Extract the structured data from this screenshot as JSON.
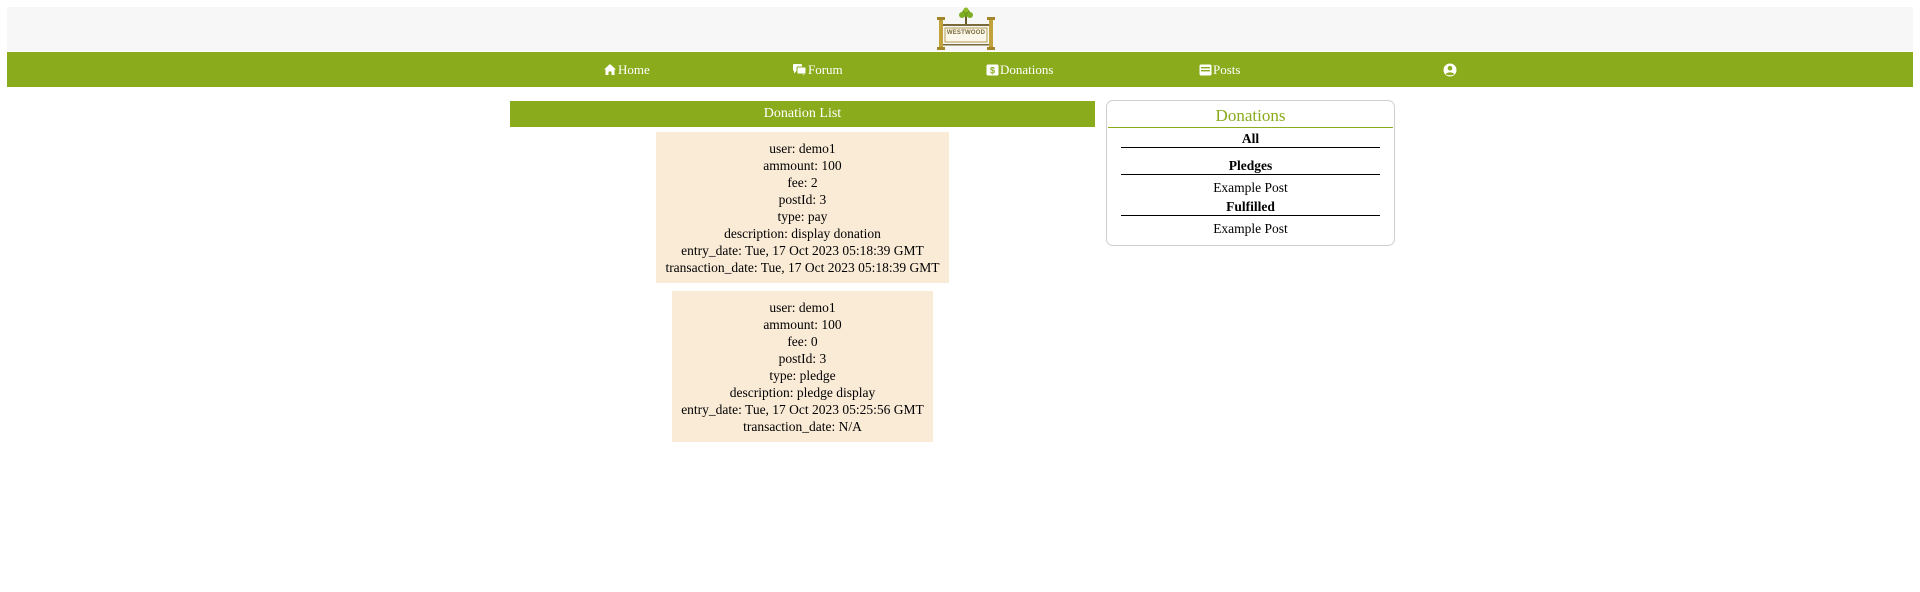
{
  "header": {
    "logo_text": "WESTWOOD"
  },
  "nav": {
    "items": [
      {
        "label": "Home",
        "icon": "home-icon"
      },
      {
        "label": "Forum",
        "icon": "chat-icon"
      },
      {
        "label": "Donations",
        "icon": "dollar-icon"
      },
      {
        "label": "Posts",
        "icon": "inbox-icon"
      },
      {
        "label": "",
        "icon": "user-circle-icon"
      }
    ]
  },
  "main": {
    "title": "Donation List",
    "donations": [
      {
        "user": "user: demo1",
        "ammount": "ammount: 100",
        "fee": "fee: 2",
        "postId": "postId: 3",
        "type": "type: pay",
        "description": "description: display donation",
        "entry_date": "entry_date: Tue, 17 Oct 2023 05:18:39 GMT",
        "transaction_date": "transaction_date: Tue, 17 Oct 2023 05:18:39 GMT"
      },
      {
        "user": "user: demo1",
        "ammount": "ammount: 100",
        "fee": "fee: 0",
        "postId": "postId: 3",
        "type": "type: pledge",
        "description": "description: pledge display",
        "entry_date": "entry_date: Tue, 17 Oct 2023 05:25:56 GMT",
        "transaction_date": "transaction_date: N/A"
      }
    ]
  },
  "sidebar": {
    "title": "Donations",
    "all_label": "All",
    "pledges_label": "Pledges",
    "pledges_items": [
      "Example Post"
    ],
    "fulfilled_label": "Fulfilled",
    "fulfilled_items": [
      "Example Post"
    ]
  },
  "colors": {
    "accent": "#8aab1c",
    "card_bg": "#faebd7",
    "header_bg": "#f7f7f7"
  }
}
